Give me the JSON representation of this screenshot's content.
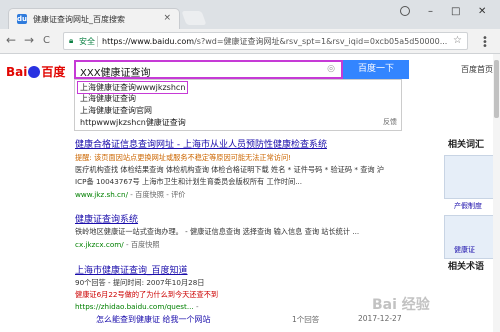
{
  "browser": {
    "tab_title": "健康证查询网址_百度搜索",
    "tab_favicon": "du",
    "close_symbol": "×",
    "url_secure": "安全",
    "url_host": "https://www.baidu.com",
    "url_rest": "/s?wd=健康证查询网址&rsv_spt=1&rsv_iqid=0xcb05a5d50000...",
    "back": "←",
    "forward": "→",
    "reload": "C"
  },
  "baidu": {
    "logo_bai": "Bai",
    "logo_du": "百度",
    "query": "XXX健康证查询",
    "search_button": "百度一下",
    "settings_link": "百度首页"
  },
  "suggestions": [
    "上海健康证查询wwwjkzshcn",
    "上海健康证查询",
    "上海健康证查询官网",
    "httpwwwjkzshcn健康证查询"
  ],
  "suggestion_feedback": "反馈",
  "results": [
    {
      "title": "健康合格证信息查询网址 - 上海市从业人员预防性健康检查系统",
      "warning": "提醒: 该页面因站点更换网址或服务不稳定等原因可能无法正常访问!",
      "line1": "医疗机构查找 体检结果查询 体检机构查询 体检合格证明下载 姓名 * 证件号码 * 验证码 * 查询 沪",
      "line2": "ICP备 10043767号 上海市卫生和计划生育委员会版权所有 工作时间...",
      "url": "www.jkz.sh.cn/",
      "url_meta": "- 百度快照 - 评价"
    },
    {
      "title": "健康证查询系统",
      "line1": "铁岭地区健康证一站式查询办理。 - 健康证信息查询 选择查询 输入信息 查询 站长统计 ...",
      "url": "cx.jkzcx.com/",
      "url_meta": "- 百度快照"
    },
    {
      "title": "上海市健康证查询_百度知道",
      "line1": "90个回答 - 提问时间: 2007年10月28日",
      "line2": "健康证6月22号做的了为什么到今天还查不到",
      "url": "https://zhidao.baidu.com/quest...",
      "url_meta": "- "
    }
  ],
  "bottom_row": {
    "text": "怎么能查到健康证 给我一个网站",
    "answers": "1个回答",
    "date": "2017-12-27"
  },
  "sidebar": {
    "heading1": "相关词汇",
    "caption1": "产假制度",
    "caption2": "健康证",
    "heading2": "相关术语"
  },
  "watermark": "Bai 经验"
}
